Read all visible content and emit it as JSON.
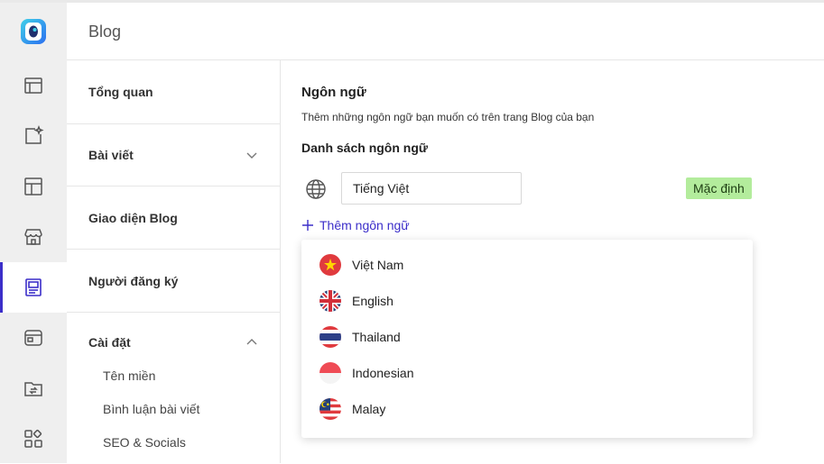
{
  "header": {
    "title": "Blog"
  },
  "sidebar_nav": {
    "items": [
      {
        "label": "Tổng quan"
      },
      {
        "label": "Bài viết"
      },
      {
        "label": "Giao diện Blog"
      },
      {
        "label": "Người đăng ký"
      },
      {
        "label": "Cài đặt"
      }
    ],
    "settings_sub": [
      {
        "label": "Tên miền"
      },
      {
        "label": "Bình luận bài viết"
      },
      {
        "label": "SEO & Socials"
      }
    ]
  },
  "language": {
    "title": "Ngôn ngữ",
    "description": "Thêm những ngôn ngữ bạn muốn có trên trang Blog của bạn",
    "list_title": "Danh sách ngôn ngữ",
    "current_value": "Tiếng Việt",
    "default_badge": "Mặc định",
    "add_label": "Thêm ngôn ngữ"
  },
  "dropdown": {
    "options": [
      {
        "label": "Việt Nam",
        "flag": "vietnam-flag"
      },
      {
        "label": "English",
        "flag": "uk-flag"
      },
      {
        "label": "Thailand",
        "flag": "thailand-flag"
      },
      {
        "label": "Indonesian",
        "flag": "indonesia-flag"
      },
      {
        "label": "Malay",
        "flag": "malaysia-flag"
      }
    ]
  },
  "colors": {
    "accent": "#3b2ec9",
    "badge_bg": "#b3ec9c",
    "rail_bg": "#efefef"
  }
}
